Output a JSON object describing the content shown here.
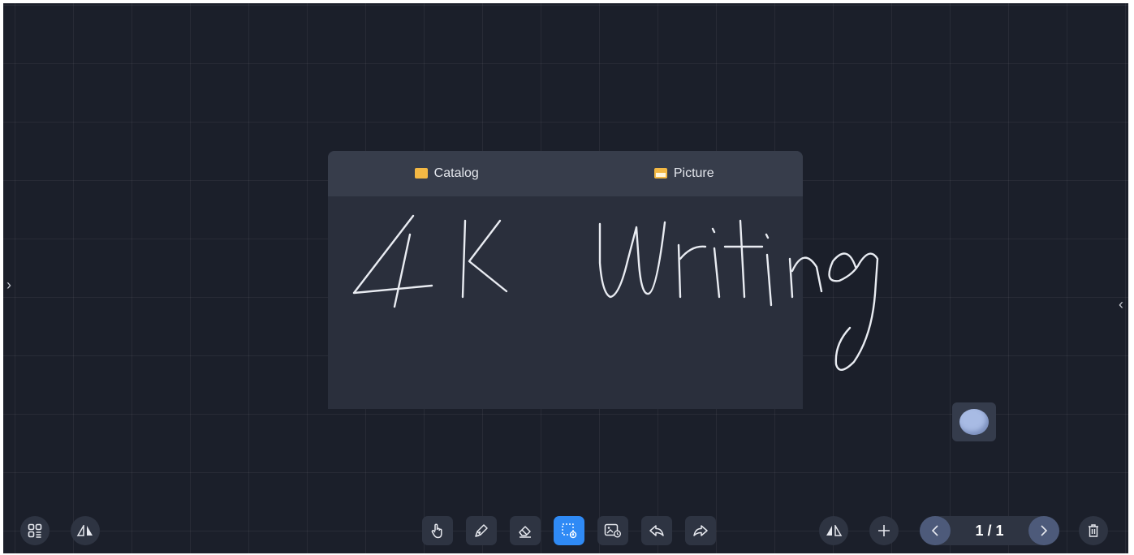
{
  "panel": {
    "tabs": [
      {
        "label": "Catalog",
        "icon": "folder-icon"
      },
      {
        "label": "Picture",
        "icon": "picture-icon"
      }
    ]
  },
  "canvas": {
    "handwriting": "4K Writing",
    "background": "#1b1f2a",
    "stroke_color": "#e9ecf2"
  },
  "toolbar": {
    "left": [
      {
        "name": "grid-menu",
        "icon": "grid-menu-icon"
      },
      {
        "name": "flip",
        "icon": "flip-icon"
      }
    ],
    "tools": [
      {
        "name": "hand",
        "icon": "hand-icon",
        "active": false
      },
      {
        "name": "pen",
        "icon": "pen-icon",
        "active": false
      },
      {
        "name": "eraser",
        "icon": "eraser-icon",
        "active": false
      },
      {
        "name": "select",
        "icon": "select-icon",
        "active": true
      },
      {
        "name": "insert-image",
        "icon": "insert-image-icon",
        "active": false
      },
      {
        "name": "undo",
        "icon": "undo-icon",
        "active": false
      },
      {
        "name": "redo",
        "icon": "redo-icon",
        "active": false
      }
    ],
    "accent_color": "#2f8af5"
  },
  "pager": {
    "label": "1 / 1"
  }
}
